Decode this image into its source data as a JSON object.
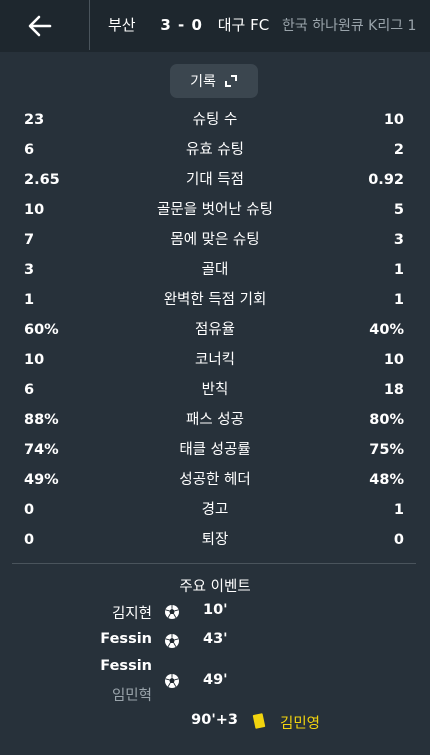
{
  "header": {
    "home_team": "부산",
    "score": "3 - 0",
    "away_team": "대구 FC",
    "league": "한국 하나원큐 K리그 1"
  },
  "record_button": {
    "label": "기록"
  },
  "stats": [
    {
      "home": "23",
      "label": "슈팅 수",
      "away": "10"
    },
    {
      "home": "6",
      "label": "유효 슈팅",
      "away": "2"
    },
    {
      "home": "2.65",
      "label": "기대 득점",
      "away": "0.92"
    },
    {
      "home": "10",
      "label": "골문을 벗어난 슈팅",
      "away": "5"
    },
    {
      "home": "7",
      "label": "몸에 맞은 슈팅",
      "away": "3"
    },
    {
      "home": "3",
      "label": "골대",
      "away": "1"
    },
    {
      "home": "1",
      "label": "완벽한 득점 기회",
      "away": "1"
    },
    {
      "home": "60%",
      "label": "점유율",
      "away": "40%"
    },
    {
      "home": "10",
      "label": "코너킥",
      "away": "10"
    },
    {
      "home": "6",
      "label": "반칙",
      "away": "18"
    },
    {
      "home": "88%",
      "label": "패스 성공",
      "away": "80%"
    },
    {
      "home": "74%",
      "label": "태클 성공률",
      "away": "75%"
    },
    {
      "home": "49%",
      "label": "성공한 헤더",
      "away": "48%"
    },
    {
      "home": "0",
      "label": "경고",
      "away": "1"
    },
    {
      "home": "0",
      "label": "퇴장",
      "away": "0"
    }
  ],
  "events": {
    "title": "주요 이벤트",
    "items": [
      {
        "scorer": "김지현",
        "minute": "10'"
      },
      {
        "scorer": "Fessin",
        "minute": "43'"
      },
      {
        "scorer": "Fessin",
        "assist": "임민혁",
        "minute": "49'"
      },
      {
        "minute": "90'+3",
        "player": "김민영"
      }
    ]
  },
  "colors": {
    "header_bg": "#1e272e",
    "content_bg": "#27313a",
    "button_bg": "#3b464f",
    "muted_text": "#9aa4ab",
    "yellow_card": "#f2d40e"
  }
}
